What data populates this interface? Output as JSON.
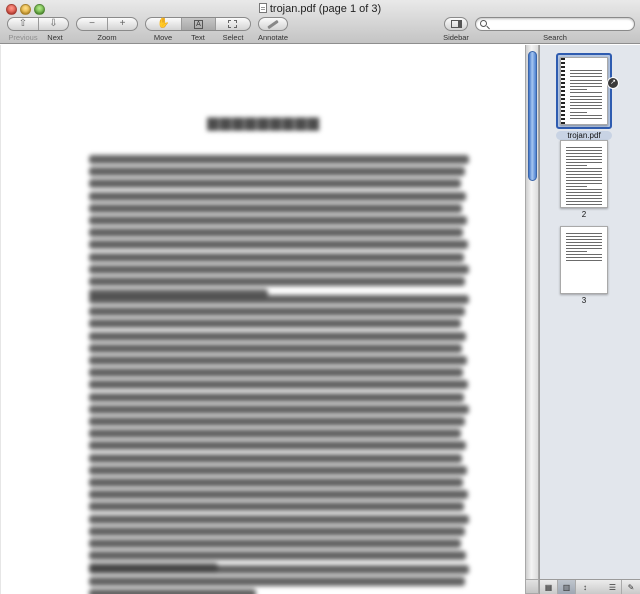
{
  "window": {
    "title": "trojan.pdf (page 1 of 3)"
  },
  "toolbar": {
    "previous_label": "Previous",
    "next_label": "Next",
    "zoom_label": "Zoom",
    "zoom_out_glyph": "−",
    "zoom_in_glyph": "+",
    "move_label": "Move",
    "text_label": "Text",
    "select_label": "Select",
    "annotate_label": "Annotate",
    "sidebar_label": "Sidebar",
    "search_label": "Search",
    "icons": {
      "previous": "arrow-up-icon",
      "next": "arrow-down-icon",
      "move": "hand-icon",
      "text": "text-cursor-icon",
      "select": "select-icon",
      "annotate": "pencil-icon",
      "sidebar": "sidebar-icon",
      "search": "magnifier-icon"
    }
  },
  "search": {
    "value": "",
    "placeholder": ""
  },
  "sidebar": {
    "thumbnails": [
      {
        "label": "trojan.pdf",
        "selected": true
      },
      {
        "label": "2",
        "selected": false
      },
      {
        "label": "3",
        "selected": false
      }
    ]
  },
  "colors": {
    "selection_border": "#2f5cb0",
    "scroll_thumb": "#5a8ad6",
    "sidebar_bg": "#e2e6ec"
  }
}
